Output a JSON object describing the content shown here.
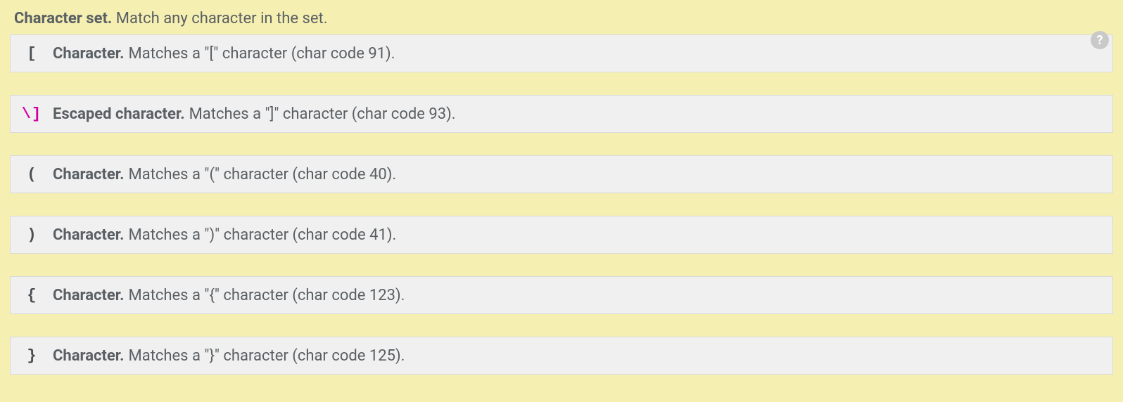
{
  "header": {
    "title": "Character set.",
    "description": "Match any character in the set."
  },
  "rows": [
    {
      "token": "[",
      "escaped": false,
      "label": "Character.",
      "text": "Matches a \"[\" character (char code 91)."
    },
    {
      "token": "\\]",
      "escaped": true,
      "label": "Escaped character.",
      "text": "Matches a \"]\" character (char code 93)."
    },
    {
      "token": "(",
      "escaped": false,
      "label": "Character.",
      "text": "Matches a \"(\" character (char code 40)."
    },
    {
      "token": ")",
      "escaped": false,
      "label": "Character.",
      "text": "Matches a \")\" character (char code 41)."
    },
    {
      "token": "{",
      "escaped": false,
      "label": "Character.",
      "text": "Matches a \"{\" character (char code 123)."
    },
    {
      "token": "}",
      "escaped": false,
      "label": "Character.",
      "text": "Matches a \"}\" character (char code 125)."
    }
  ]
}
